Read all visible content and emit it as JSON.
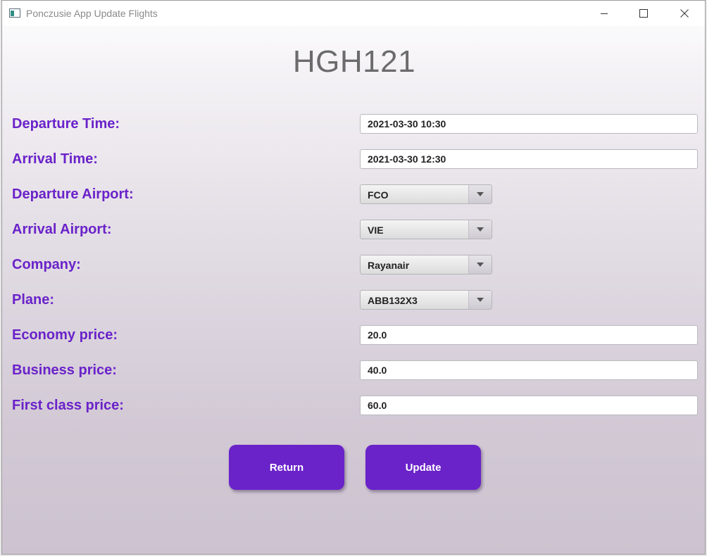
{
  "window": {
    "title": "Ponczusie App Update Flights"
  },
  "header": {
    "flight_code": "HGH121"
  },
  "form": {
    "departure_time": {
      "label": "Departure Time:",
      "value": "2021-03-30 10:30"
    },
    "arrival_time": {
      "label": "Arrival Time:",
      "value": "2021-03-30 12:30"
    },
    "departure_airport": {
      "label": "Departure Airport:",
      "value": "FCO"
    },
    "arrival_airport": {
      "label": "Arrival Airport:",
      "value": "VIE"
    },
    "company": {
      "label": "Company:",
      "value": "Rayanair"
    },
    "plane": {
      "label": "Plane:",
      "value": "ABB132X3"
    },
    "economy_price": {
      "label": "Economy price:",
      "value": "20.0"
    },
    "business_price": {
      "label": "Business price:",
      "value": "40.0"
    },
    "first_class_price": {
      "label": "First class price:",
      "value": "60.0"
    }
  },
  "actions": {
    "return_label": "Return",
    "update_label": "Update"
  },
  "icons": {
    "app": "app-window-icon",
    "minimize": "minimize-icon",
    "maximize": "maximize-icon",
    "close": "close-icon",
    "dropdown": "chevron-down-icon"
  },
  "colors": {
    "accent": "#6a22c9",
    "label": "#6a22c9",
    "title_text": "#6b6b6b",
    "button_text": "#ffffff"
  }
}
